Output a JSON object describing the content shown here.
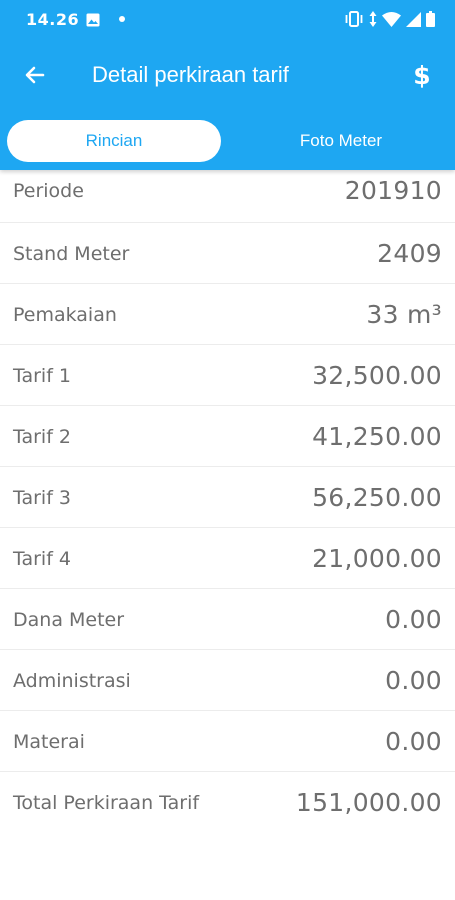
{
  "status_bar": {
    "time": "14.26"
  },
  "toolbar": {
    "title": "Detail perkiraan tarif",
    "back_icon": "arrow-left-icon",
    "action_icon": "dollar-icon",
    "action_glyph": "$"
  },
  "tabs": [
    {
      "label": "Rincian",
      "active": true
    },
    {
      "label": "Foto Meter",
      "active": false
    }
  ],
  "details": [
    {
      "label": "Periode",
      "value": "201910"
    },
    {
      "label": "Stand Meter",
      "value": "2409"
    },
    {
      "label": "Pemakaian",
      "value": "33 m³"
    },
    {
      "label": "Tarif 1",
      "value": "32,500.00"
    },
    {
      "label": "Tarif 2",
      "value": "41,250.00"
    },
    {
      "label": "Tarif 3",
      "value": "56,250.00"
    },
    {
      "label": "Tarif 4",
      "value": "21,000.00"
    },
    {
      "label": "Dana Meter",
      "value": "0.00"
    },
    {
      "label": "Administrasi",
      "value": "0.00"
    },
    {
      "label": "Materai",
      "value": "0.00"
    },
    {
      "label": "Total Perkiraan Tarif",
      "value": "151,000.00"
    }
  ],
  "colors": {
    "primary": "#1ea7f2",
    "text": "#6e6e6e",
    "divider": "#ececec"
  }
}
